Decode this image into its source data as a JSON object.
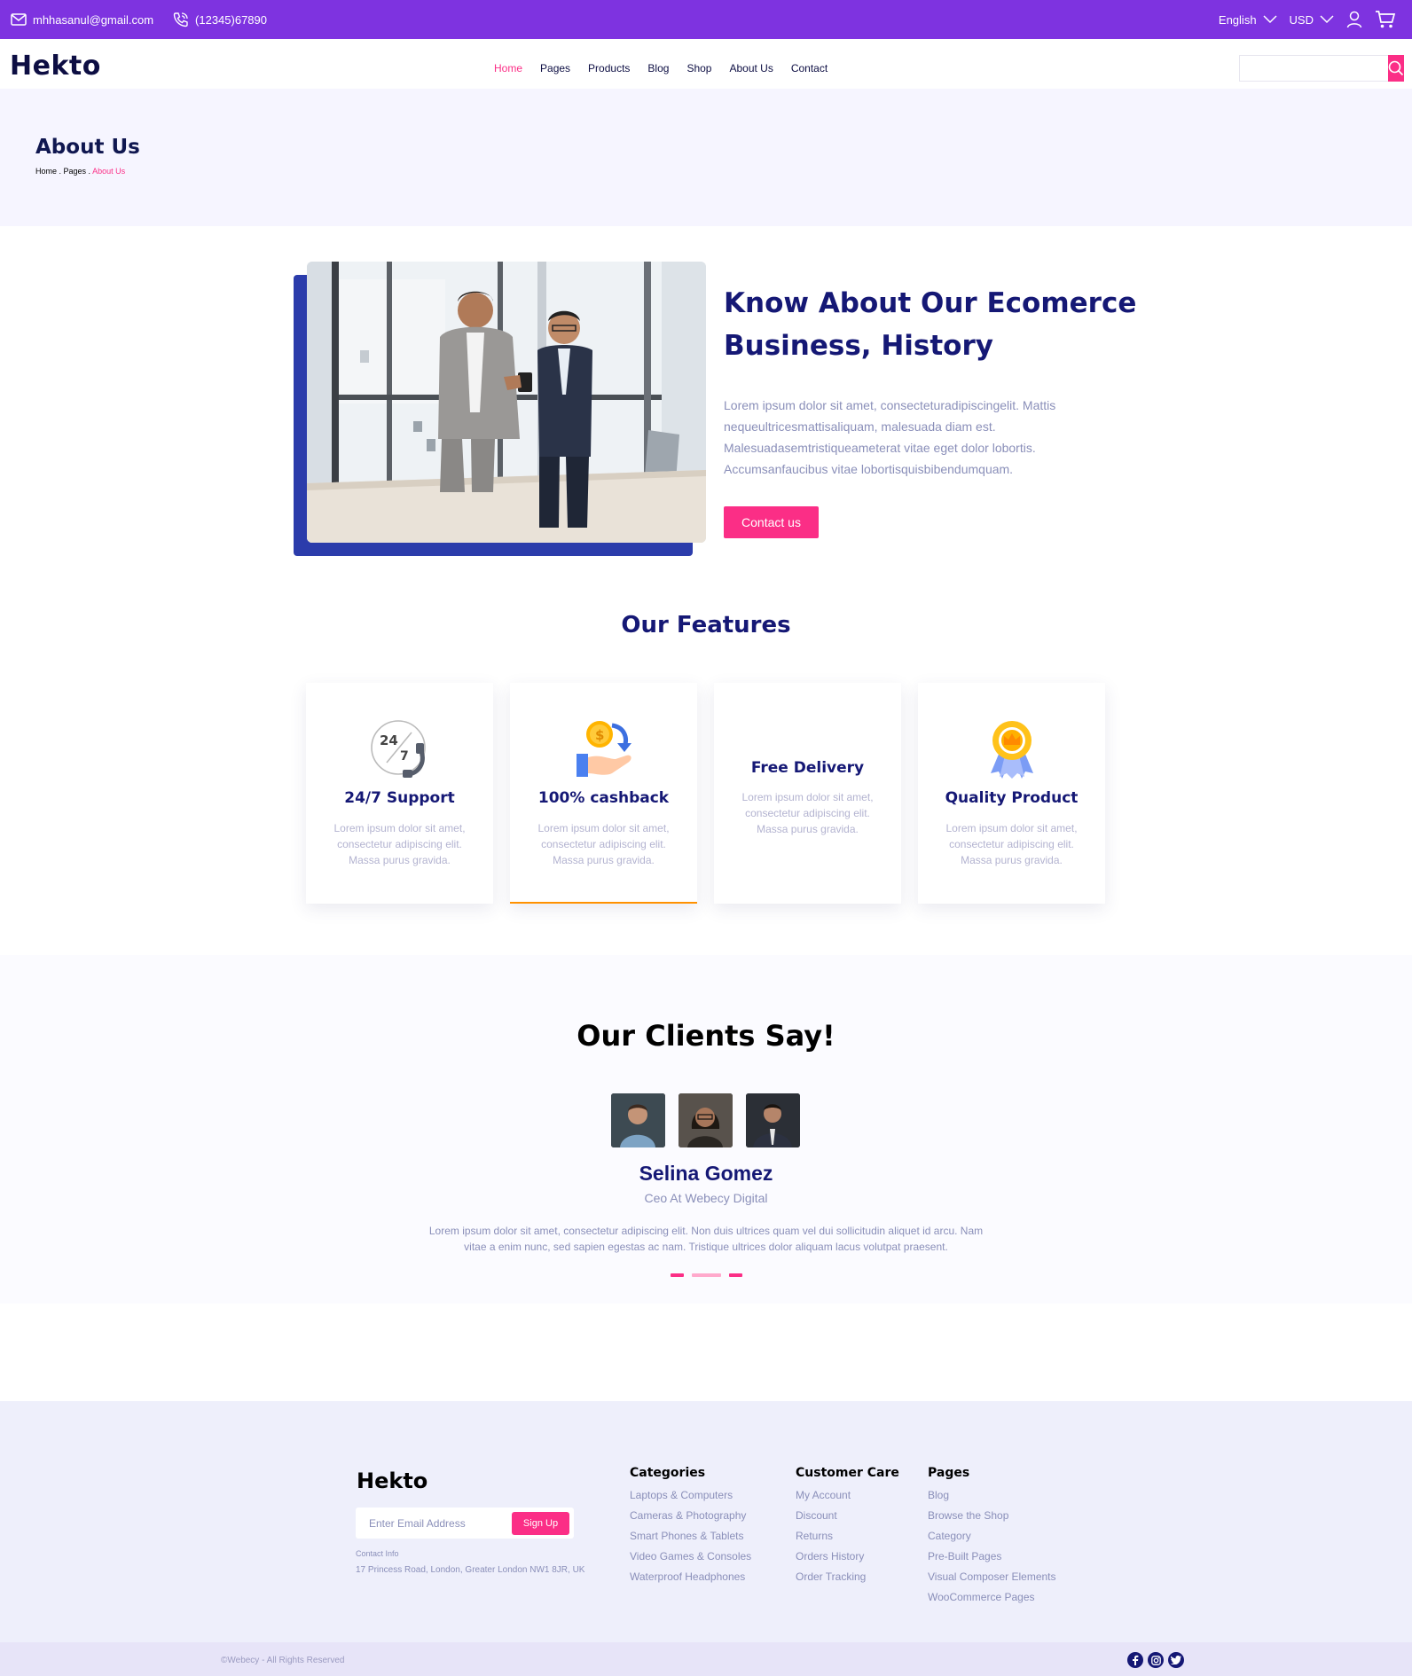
{
  "topbar": {
    "email": "mhhasanul@gmail.com",
    "phone": "(12345)67890",
    "language": "English",
    "currency": "USD"
  },
  "nav": {
    "logo": "Hekto",
    "menu": [
      "Home",
      "Pages",
      "Products",
      "Blog",
      "Shop",
      "About Us",
      "Contact"
    ],
    "search_placeholder": ""
  },
  "hero": {
    "title": "About Us",
    "breadcrumb": [
      "Home .",
      "Pages .",
      "About Us"
    ]
  },
  "about": {
    "heading_line1": "Know About Our Ecomerce",
    "heading_line2": "Business, History",
    "description": "Lorem ipsum dolor sit amet, consecteturadipiscingelit. Mattis nequeultricesmattisaliquam, malesuada diam est. Malesuadasemtristiqueameterat vitae eget dolor lobortis. Accumsanfaucibus vitae lobortisquisbibendumquam.",
    "cta": "Contact us"
  },
  "features": {
    "title": "Our Features",
    "cards": [
      {
        "title": "24/7 Support",
        "text": "Lorem ipsum dolor sit amet, consectetur adipiscing elit. Massa purus gravida.",
        "icon": "support-24-7-icon"
      },
      {
        "title": "100% cashback",
        "text": "Lorem ipsum dolor sit amet, consectetur adipiscing elit. Massa purus gravida.",
        "icon": "cashback-icon"
      },
      {
        "title": "Free Delivery",
        "text": "Lorem ipsum dolor sit amet, consectetur adipiscing elit. Massa purus gravida.",
        "icon": "none"
      },
      {
        "title": "Quality Product",
        "text": "Lorem ipsum dolor sit amet, consectetur adipiscing elit. Massa purus gravida.",
        "icon": "award-medal-icon"
      }
    ]
  },
  "clients": {
    "title": "Our Clients Say!",
    "name": "Selina Gomez",
    "role": "Ceo At Webecy Digital",
    "quote": "Lorem ipsum dolor sit amet, consectetur adipiscing elit. Non duis ultrices quam vel dui sollicitudin aliquet id arcu. Nam vitae a enim nunc, sed sapien egestas ac nam. Tristique ultrices dolor aliquam lacus volutpat praesent."
  },
  "footer": {
    "logo": "Hekto",
    "email_placeholder": "Enter Email Address",
    "signup": "Sign Up",
    "contact_label": "Contact Info",
    "address": "17 Princess Road, London, Greater London NW1 8JR, UK",
    "columns": [
      {
        "title": "Categories",
        "links": [
          "Laptops & Computers",
          "Cameras & Photography",
          "Smart Phones & Tablets",
          "Video Games & Consoles",
          "Waterproof Headphones"
        ]
      },
      {
        "title": "Customer Care",
        "links": [
          "My Account",
          "Discount",
          "Returns",
          "Orders History",
          "Order Tracking"
        ]
      },
      {
        "title": "Pages",
        "links": [
          "Blog",
          "Browse the Shop",
          "Category",
          "Pre-Built Pages",
          "Visual Composer Elements",
          "WooCommerce Pages"
        ]
      }
    ],
    "copyright": "©Webecy - All Rights Reserved"
  },
  "colors": {
    "topbar": "#7e33e0",
    "accent": "#fb2e86",
    "navy": "#151875",
    "hero_bg": "#f6f5ff",
    "footer_bg": "#eeeffb"
  }
}
